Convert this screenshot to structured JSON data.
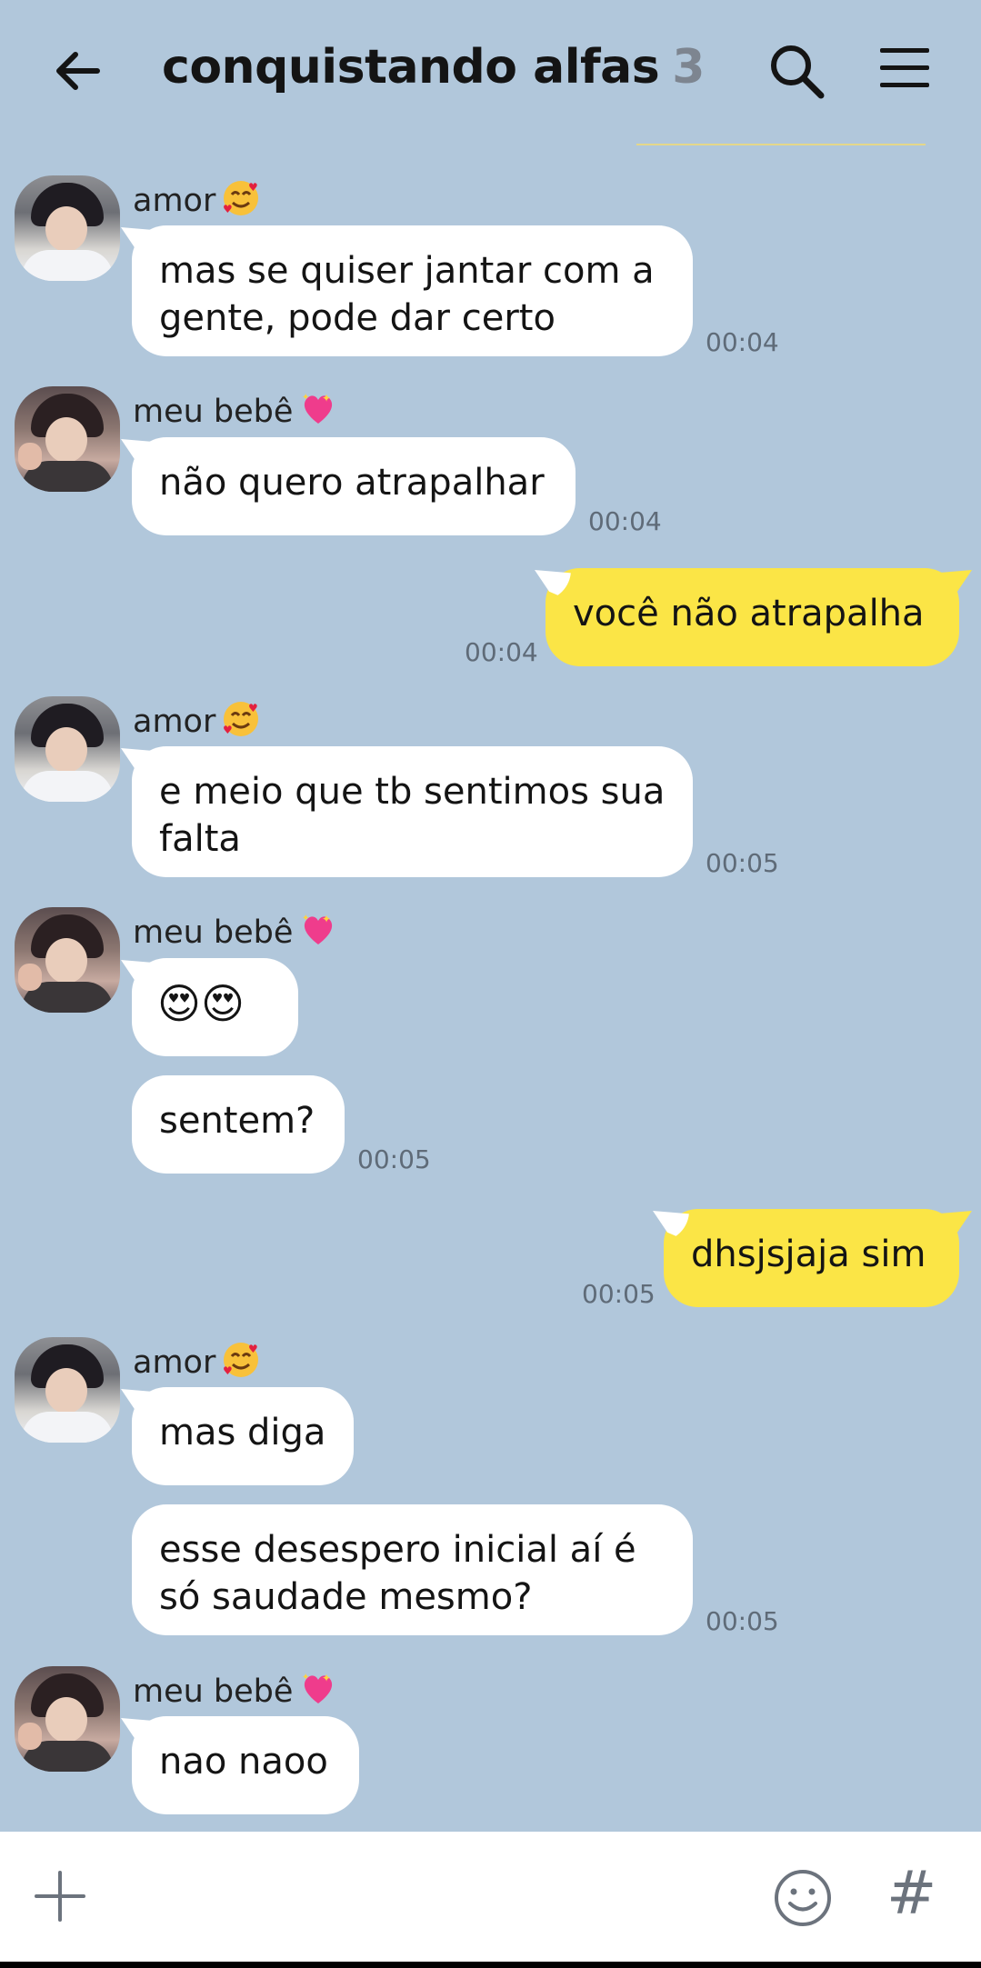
{
  "header": {
    "title": "conquistando alfas",
    "member_count": "3",
    "back_icon": "back-arrow-icon",
    "search_icon": "search-icon",
    "menu_icon": "menu-icon"
  },
  "messages": [
    {
      "sender": "amor",
      "emoji": "smiling-face-with-hearts",
      "text": "mas se quiser jantar com a gente, pode dar certo",
      "time": "00:04"
    },
    {
      "sender": "meu bebê",
      "emoji": "sparkling-heart",
      "text": "não quero atrapalhar",
      "time": "00:04"
    },
    {
      "sender": "me",
      "text": "você não atrapalha",
      "time": "00:04"
    },
    {
      "sender": "amor",
      "emoji": "smiling-face-with-hearts",
      "text": "e meio que tb sentimos sua falta",
      "time": "00:05"
    },
    {
      "sender": "meu bebê",
      "emoji": "sparkling-heart",
      "text": "😍😍",
      "time": ""
    },
    {
      "sender": "meu bebê",
      "text": "sentem?",
      "time": "00:05"
    },
    {
      "sender": "me",
      "text": "dhsjsjaja sim",
      "time": "00:05"
    },
    {
      "sender": "amor",
      "emoji": "smiling-face-with-hearts",
      "text": "mas diga",
      "time": ""
    },
    {
      "sender": "amor",
      "text": "esse desespero inicial aí é só saudade mesmo?",
      "time": "00:05"
    },
    {
      "sender": "meu bebê",
      "emoji": "sparkling-heart",
      "text": "nao naoo",
      "time": ""
    }
  ],
  "footer": {
    "plus_icon": "plus-icon",
    "emoji_icon": "smiley-icon",
    "hash_label": "#"
  },
  "colors": {
    "background": "#b1c7db",
    "my_bubble": "#fbe546",
    "other_bubble": "#ffffff",
    "time_text": "#5f6b78"
  }
}
